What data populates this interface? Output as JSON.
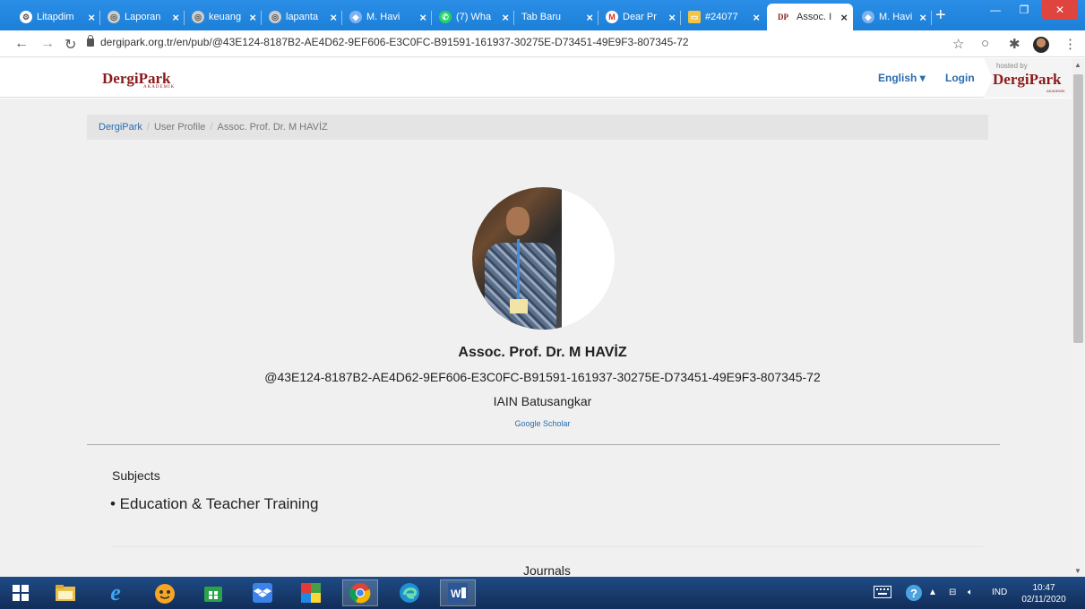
{
  "browser": {
    "tabs": [
      {
        "title": "Litapdim",
        "icon": "gear-icon"
      },
      {
        "title": "Laporan",
        "icon": "globe-icon"
      },
      {
        "title": "keuang",
        "icon": "globe-icon"
      },
      {
        "title": "lapanta",
        "icon": "globe-icon"
      },
      {
        "title": "M. Havi",
        "icon": "scholar-icon"
      },
      {
        "title": "(7) Wha",
        "icon": "whatsapp-icon"
      },
      {
        "title": "Tab Baru",
        "icon": ""
      },
      {
        "title": "Dear Pr",
        "icon": "gmail-icon"
      },
      {
        "title": "#24077",
        "icon": "folder-icon"
      },
      {
        "title": "Assoc. I",
        "icon": "dergipark-icon",
        "active": true
      },
      {
        "title": "M. Havi",
        "icon": "scholar-icon"
      }
    ],
    "url": "dergipark.org.tr/en/pub/@43E124-8187B2-AE4D62-9EF606-E3C0FC-B91591-161937-30275E-D73451-49E9F3-807345-72"
  },
  "site": {
    "logo": "DergiPark",
    "logo_sub": "AKADEMİK",
    "language": "English",
    "login": "Login",
    "hosted_by": "hosted by",
    "hosted_logo": "DergiPark",
    "hosted_sub": "AKADEMİK"
  },
  "breadcrumb": {
    "home": "DergiPark",
    "profile": "User Profile",
    "current": "Assoc. Prof. Dr. M HAVİZ"
  },
  "profile": {
    "name": "Assoc. Prof. Dr. M HAVİZ",
    "handle": "@43E124-8187B2-AE4D62-9EF606-E3C0FC-B91591-161937-30275E-D73451-49E9F3-807345-72",
    "institution": "IAIN Batusangkar",
    "scholar_link": "Google Scholar"
  },
  "sections": {
    "subjects_heading": "Subjects",
    "subjects": [
      "• Education & Teacher Training"
    ],
    "journals_heading": "Journals"
  },
  "taskbar": {
    "language": "IND",
    "time": "10:47",
    "date": "02/11/2020"
  }
}
